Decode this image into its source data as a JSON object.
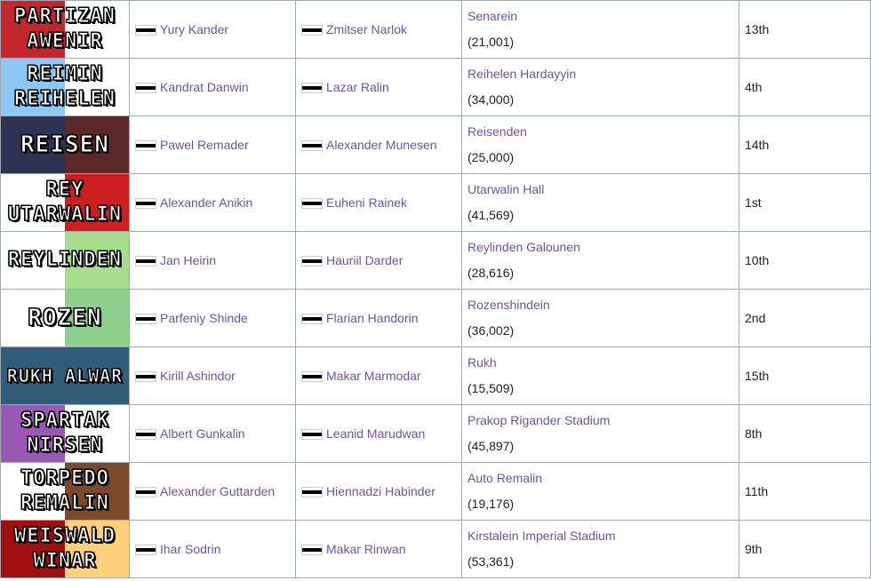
{
  "rows": [
    {
      "badge": {
        "line1": "PARTIZAN",
        "line2": "AWENIR",
        "colors": [
          "#c1272d",
          "#ffffff"
        ]
      },
      "manager": "Yury Kander",
      "captain": "Zmitser Narlok",
      "stadium": "Senarein",
      "capacity": "(21,001)",
      "position": "13th"
    },
    {
      "badge": {
        "line1": "REIMIN",
        "line2": "REIHELEN",
        "colors": [
          "#8ec9f5",
          "#ffffff"
        ]
      },
      "manager": "Kandrat Danwin",
      "captain": "Lazar Ralin",
      "stadium": "Reihelen Hardayyin",
      "capacity": "(34,000)",
      "position": "4th"
    },
    {
      "badge": {
        "line1": "REISEN",
        "line2": "",
        "colors": [
          "#2e3354",
          "#5c2828"
        ]
      },
      "manager": "Pawel Remader",
      "captain": "Alexander Munesen",
      "stadium": "Reisenden",
      "capacity": "(25,000)",
      "position": "14th"
    },
    {
      "badge": {
        "line1": "REY",
        "line2": "UTARWALIN",
        "colors": [
          "#ffffff",
          "#cc2020"
        ]
      },
      "manager": "Alexander Anikin",
      "captain": "Euheni Rainek",
      "stadium": "Utarwalin Hall",
      "capacity": "(41,569)",
      "position": "1st"
    },
    {
      "badge": {
        "line1": "REYLINDEN",
        "line2": "",
        "colors": [
          "#ffffff",
          "#a6dd8c"
        ]
      },
      "manager": "Jan Heirin",
      "captain": "Hauriil Darder",
      "stadium": "Reylinden Galounen",
      "capacity": "(28,616)",
      "position": "10th"
    },
    {
      "badge": {
        "line1": "ROZEN",
        "line2": "",
        "colors": [
          "#ffffff",
          "#8ed18e"
        ]
      },
      "manager": "Parfeniy Shinde",
      "captain": "Flarian Handorin",
      "stadium": "Rozenshindein",
      "capacity": "(36,002)",
      "position": "2nd"
    },
    {
      "badge": {
        "line1": "RUKH ALWAR",
        "line2": "",
        "colors": [
          "#2f5d7a",
          "#2f5d7a"
        ]
      },
      "manager": "Kirill Ashindor",
      "captain": "Makar Marmodar",
      "stadium": "Rukh",
      "capacity": "(15,509)",
      "position": "15th"
    },
    {
      "badge": {
        "line1": "SPARTAK",
        "line2": "NIRSEN",
        "colors": [
          "#9b59b6",
          "#ffffff"
        ]
      },
      "manager": "Albert Gunkalin",
      "captain": "Leanid Marudwan",
      "stadium": "Prakop Rigander Stadium",
      "capacity": "(45,897)",
      "position": "8th"
    },
    {
      "badge": {
        "line1": "TORPEDO",
        "line2": "REMALIN",
        "colors": [
          "#ffffff",
          "#7a4a2a"
        ]
      },
      "manager": "Alexander Guttarden",
      "captain": "Hiennadzi Habinder",
      "stadium": "Auto Remalin",
      "capacity": "(19,176)",
      "position": "11th"
    },
    {
      "badge": {
        "line1": "WEISWALD",
        "line2": "WINAR",
        "colors": [
          "#a11010",
          "#ffcf7a"
        ]
      },
      "manager": "Ihar Sodrin",
      "captain": "Makar Rinwan",
      "stadium": "Kirstalein Imperial Stadium",
      "capacity": "(53,361)",
      "position": "9th"
    }
  ]
}
